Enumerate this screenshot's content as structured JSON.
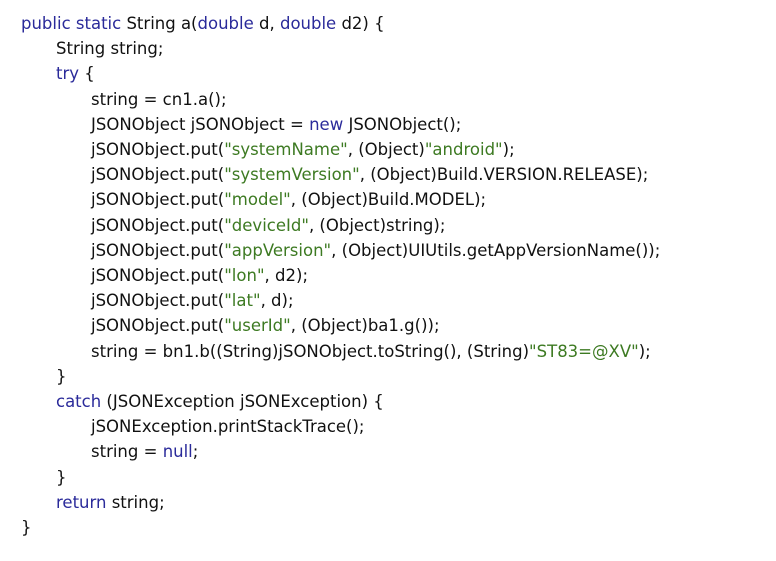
{
  "colors": {
    "background": "#ffffff",
    "plain_text": "#111111",
    "keyword": "#2a2a9a",
    "string_literal": "#3d7a22"
  },
  "code": {
    "lines": [
      {
        "indent": 0,
        "tokens": [
          {
            "t": "kw",
            "v": "public"
          },
          {
            "t": "plain",
            "v": " "
          },
          {
            "t": "kw",
            "v": "static"
          },
          {
            "t": "plain",
            "v": " String a("
          },
          {
            "t": "kw",
            "v": "double"
          },
          {
            "t": "plain",
            "v": " d, "
          },
          {
            "t": "kw",
            "v": "double"
          },
          {
            "t": "plain",
            "v": " d2) {"
          }
        ]
      },
      {
        "indent": 1,
        "tokens": [
          {
            "t": "plain",
            "v": "String string;"
          }
        ]
      },
      {
        "indent": 1,
        "tokens": [
          {
            "t": "kw",
            "v": "try"
          },
          {
            "t": "plain",
            "v": " {"
          }
        ]
      },
      {
        "indent": 2,
        "tokens": [
          {
            "t": "plain",
            "v": "string = cn1.a();"
          }
        ]
      },
      {
        "indent": 2,
        "tokens": [
          {
            "t": "plain",
            "v": "JSONObject jSONObject = "
          },
          {
            "t": "kw",
            "v": "new"
          },
          {
            "t": "plain",
            "v": " JSONObject();"
          }
        ]
      },
      {
        "indent": 2,
        "tokens": [
          {
            "t": "plain",
            "v": "jSONObject.put("
          },
          {
            "t": "str",
            "v": "\"systemName\""
          },
          {
            "t": "plain",
            "v": ", (Object)"
          },
          {
            "t": "str",
            "v": "\"android\""
          },
          {
            "t": "plain",
            "v": ");"
          }
        ]
      },
      {
        "indent": 2,
        "tokens": [
          {
            "t": "plain",
            "v": "jSONObject.put("
          },
          {
            "t": "str",
            "v": "\"systemVersion\""
          },
          {
            "t": "plain",
            "v": ", (Object)Build.VERSION.RELEASE);"
          }
        ]
      },
      {
        "indent": 2,
        "tokens": [
          {
            "t": "plain",
            "v": "jSONObject.put("
          },
          {
            "t": "str",
            "v": "\"model\""
          },
          {
            "t": "plain",
            "v": ", (Object)Build.MODEL);"
          }
        ]
      },
      {
        "indent": 2,
        "tokens": [
          {
            "t": "plain",
            "v": "jSONObject.put("
          },
          {
            "t": "str",
            "v": "\"deviceId\""
          },
          {
            "t": "plain",
            "v": ", (Object)string);"
          }
        ]
      },
      {
        "indent": 2,
        "tokens": [
          {
            "t": "plain",
            "v": "jSONObject.put("
          },
          {
            "t": "str",
            "v": "\"appVersion\""
          },
          {
            "t": "plain",
            "v": ", (Object)UIUtils.getAppVersionName());"
          }
        ]
      },
      {
        "indent": 2,
        "tokens": [
          {
            "t": "plain",
            "v": "jSONObject.put("
          },
          {
            "t": "str",
            "v": "\"lon\""
          },
          {
            "t": "plain",
            "v": ", d2);"
          }
        ]
      },
      {
        "indent": 2,
        "tokens": [
          {
            "t": "plain",
            "v": "jSONObject.put("
          },
          {
            "t": "str",
            "v": "\"lat\""
          },
          {
            "t": "plain",
            "v": ", d);"
          }
        ]
      },
      {
        "indent": 2,
        "tokens": [
          {
            "t": "plain",
            "v": "jSONObject.put("
          },
          {
            "t": "str",
            "v": "\"userId\""
          },
          {
            "t": "plain",
            "v": ", (Object)ba1.g());"
          }
        ]
      },
      {
        "indent": 2,
        "tokens": [
          {
            "t": "plain",
            "v": "string = bn1.b((String)jSONObject.toString(), (String)"
          },
          {
            "t": "str",
            "v": "\"ST83=@XV\""
          },
          {
            "t": "plain",
            "v": ");"
          }
        ]
      },
      {
        "indent": 1,
        "tokens": [
          {
            "t": "plain",
            "v": "}"
          }
        ]
      },
      {
        "indent": 1,
        "tokens": [
          {
            "t": "kw",
            "v": "catch"
          },
          {
            "t": "plain",
            "v": " (JSONException jSONException) {"
          }
        ]
      },
      {
        "indent": 2,
        "tokens": [
          {
            "t": "plain",
            "v": "jSONException.printStackTrace();"
          }
        ]
      },
      {
        "indent": 2,
        "tokens": [
          {
            "t": "plain",
            "v": "string = "
          },
          {
            "t": "kw",
            "v": "null"
          },
          {
            "t": "plain",
            "v": ";"
          }
        ]
      },
      {
        "indent": 1,
        "tokens": [
          {
            "t": "plain",
            "v": "}"
          }
        ]
      },
      {
        "indent": 1,
        "tokens": [
          {
            "t": "kw",
            "v": "return"
          },
          {
            "t": "plain",
            "v": " string;"
          }
        ]
      },
      {
        "indent": 0,
        "tokens": [
          {
            "t": "plain",
            "v": "}"
          }
        ]
      }
    ]
  }
}
